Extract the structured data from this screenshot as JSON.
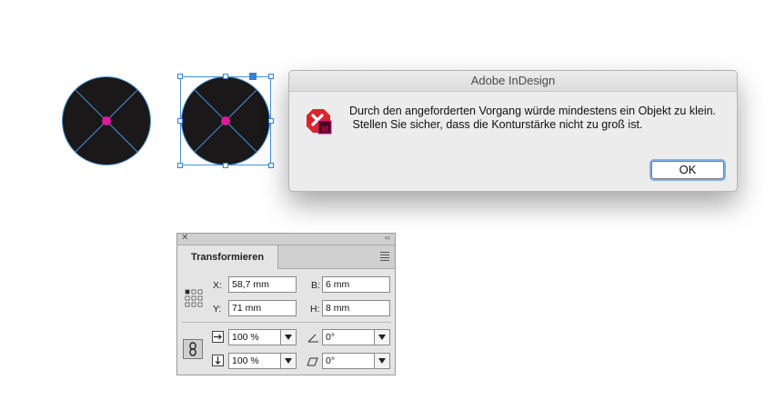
{
  "dialog": {
    "title": "Adobe InDesign",
    "icon": "indesign-alert-icon",
    "message_line1": "Durch den angeforderten Vorgang würde mindestens ein Objekt zu klein.",
    "message_line2": " Stellen Sie sicher, dass die Konturstärke nicht zu groß ist.",
    "ok_label": "OK",
    "icon_badge": "Id"
  },
  "panel": {
    "close_glyph": "✕",
    "collapse_glyph": "‹‹",
    "tab_label": "Transformieren",
    "x_label": "X:",
    "x_value": "58,7 mm",
    "y_label": "Y:",
    "y_value": "71 mm",
    "w_label": "B:",
    "w_value": "6 mm",
    "h_label": "H:",
    "h_value": "8 mm",
    "scale_x_value": "100 %",
    "scale_y_value": "100 %",
    "rotation_value": "0°",
    "shear_value": "0°"
  },
  "colors": {
    "circle_fill": "#1a1818",
    "crosshair": "#4a90d9",
    "center_point": "#e0189a",
    "selection": "#3a7fd0",
    "alert_red": "#d7262e",
    "indesign_pink": "#e0118a"
  }
}
